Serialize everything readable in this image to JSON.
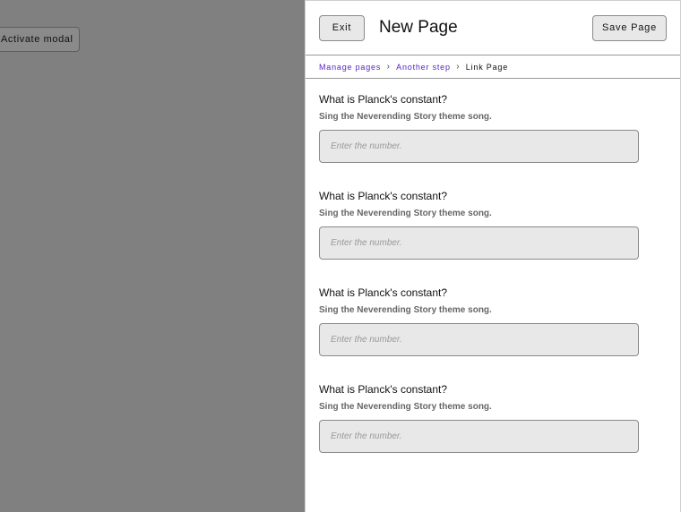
{
  "background": {
    "activate_label": "Activate modal"
  },
  "header": {
    "exit_label": "Exit",
    "title": "New Page",
    "save_label": "Save Page"
  },
  "breadcrumb": {
    "items": [
      {
        "label": "Manage pages",
        "link": true
      },
      {
        "label": "Another step",
        "link": true
      },
      {
        "label": "Link Page",
        "link": false
      }
    ],
    "separator_icon": "chevron-right-icon"
  },
  "questions": [
    {
      "title": "What is Planck's constant?",
      "description": "Sing the Neverending Story theme song.",
      "value": "",
      "placeholder": "Enter the number."
    },
    {
      "title": "What is Planck's constant?",
      "description": "Sing the Neverending Story theme song.",
      "value": "",
      "placeholder": "Enter the number."
    },
    {
      "title": "What is Planck's constant?",
      "description": "Sing the Neverending Story theme song.",
      "value": "",
      "placeholder": "Enter the number."
    },
    {
      "title": "What is Planck's constant?",
      "description": "Sing the Neverending Story theme song.",
      "value": "",
      "placeholder": "Enter the number."
    }
  ],
  "colors": {
    "backdrop": "#808080",
    "link": "#5b21c5",
    "input_bg": "#e8e8e8"
  }
}
